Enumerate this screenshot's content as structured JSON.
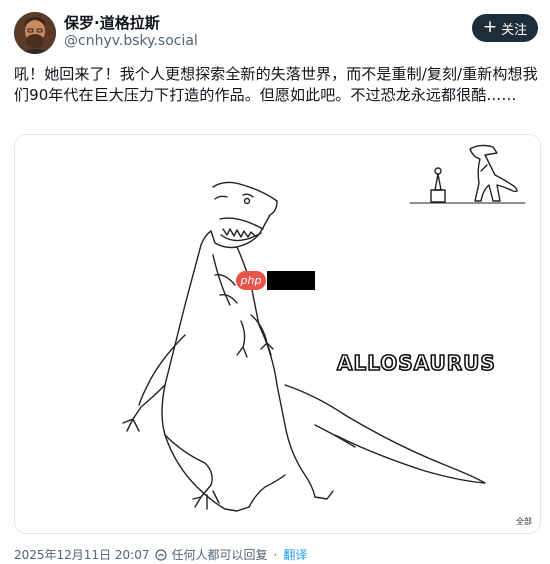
{
  "author": {
    "display_name": "保罗·道格拉斯",
    "handle": "@cnhyv.bsky.social"
  },
  "follow_button_label": "关注",
  "post": {
    "text": "吼！她回来了！我个人更想探索全新的失落世界，而不是重制/复刻/重新构想我们90年代在巨大压力下打造的作品。但愿如此吧。不过恐龙永远都很酷……"
  },
  "image": {
    "title": "ALLOSAURUS",
    "all_label": "全部",
    "watermark": "php"
  },
  "footer": {
    "timestamp": "2025年12月11日 20:07",
    "reply_setting": "任何人都可以回复",
    "separator": "·",
    "translate": "翻译"
  },
  "colors": {
    "follow_bg": "#1e2d3a",
    "link": "#1d9bf0",
    "muted": "#536471"
  }
}
